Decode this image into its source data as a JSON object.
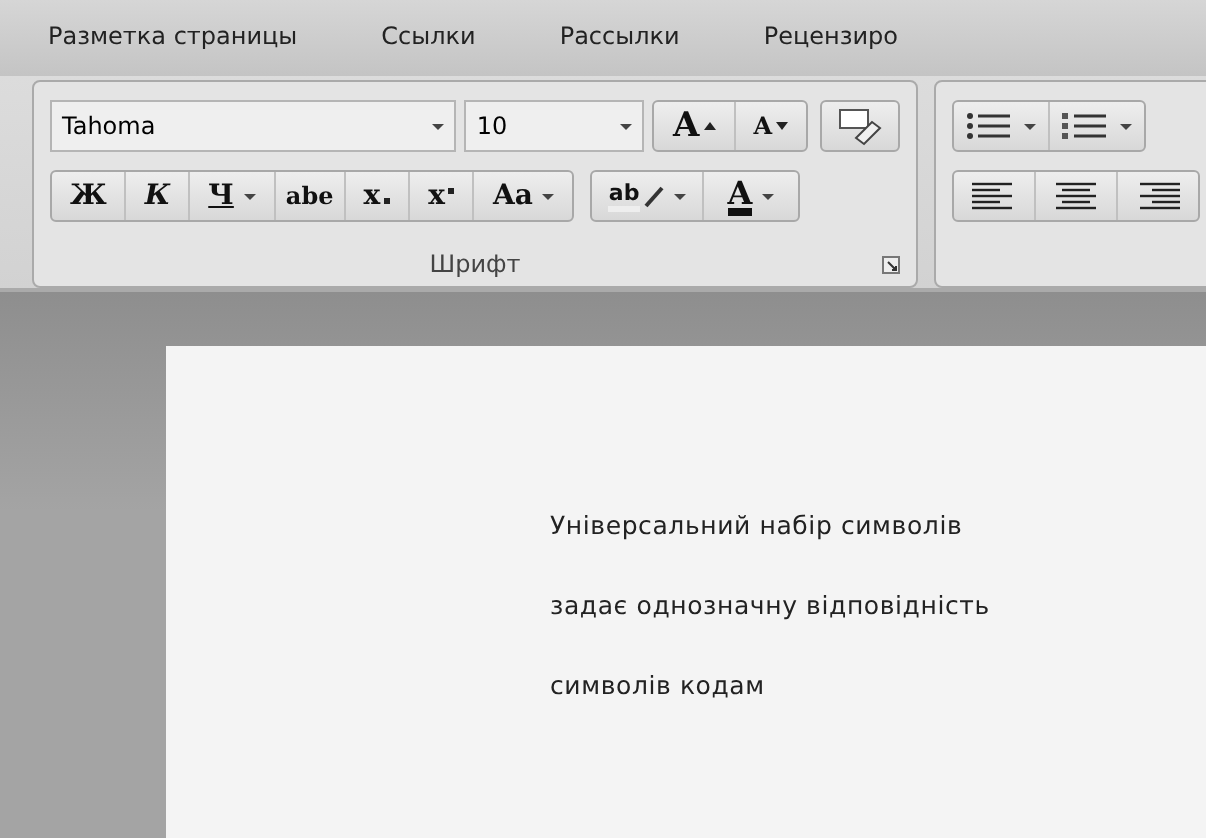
{
  "tabs": [
    {
      "label": "Разметка страницы",
      "selected": false
    },
    {
      "label": "Ссылки",
      "selected": false
    },
    {
      "label": "Рассылки",
      "selected": false
    },
    {
      "label": "Рецензиро",
      "selected": false
    }
  ],
  "font_group": {
    "font_name": "Tahoma",
    "font_size": "10",
    "grow_label": "A",
    "shrink_label": "A",
    "format_buttons": [
      {
        "kind": "bold",
        "label": "Ж",
        "dropdown": false
      },
      {
        "kind": "italic",
        "label": "К",
        "dropdown": false
      },
      {
        "kind": "underline",
        "label": "Ч",
        "dropdown": true
      },
      {
        "kind": "strike",
        "label": "abe",
        "dropdown": false
      },
      {
        "kind": "sub",
        "label": "x",
        "dropdown": false
      },
      {
        "kind": "sup",
        "label": "x",
        "dropdown": false
      },
      {
        "kind": "case",
        "label": "Aa",
        "dropdown": true
      }
    ],
    "highlight_label": "ab",
    "color_label": "A",
    "title": "Шрифт"
  },
  "document": {
    "lines": [
      "Універсальний  набір  символів",
      "задає однозначну  відповідність",
      "символів  кодам"
    ]
  }
}
